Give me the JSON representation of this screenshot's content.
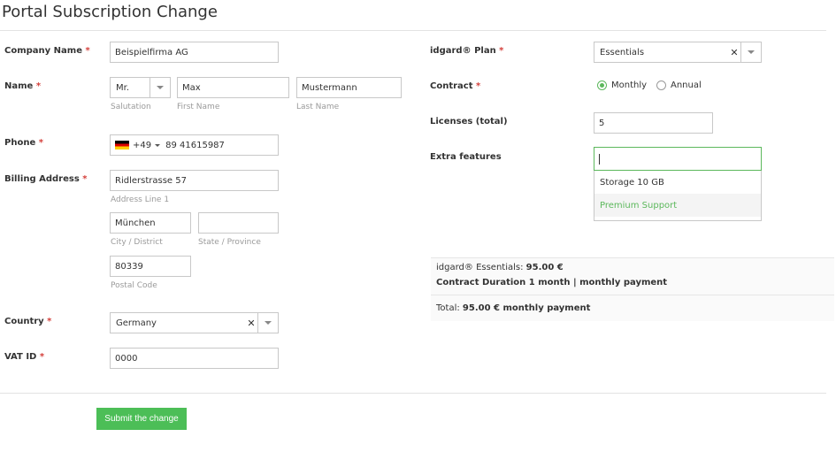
{
  "header": {
    "title": "Portal Subscription Change"
  },
  "company": {
    "label": "Company Name",
    "req": "*",
    "value": "Beispielfirma AG"
  },
  "name": {
    "label": "Name",
    "req": "*",
    "salutation": {
      "value": "Mr.",
      "hint": "Salutation"
    },
    "first": {
      "value": "Max",
      "hint": "First Name"
    },
    "last": {
      "value": "Mustermann",
      "hint": "Last Name"
    }
  },
  "phone": {
    "label": "Phone",
    "req": "*",
    "code": "+49",
    "value": "89 41615987"
  },
  "billing": {
    "label": "Billing Address",
    "req": "*",
    "line1": {
      "value": "Ridlerstrasse 57",
      "hint": "Address Line 1"
    },
    "city": {
      "value": "München",
      "hint": "City / District"
    },
    "state": {
      "value": "",
      "hint": "State / Province"
    },
    "postal": {
      "value": "80339",
      "hint": "Postal Code"
    }
  },
  "country": {
    "label": "Country",
    "req": "*",
    "value": "Germany"
  },
  "vat": {
    "label": "VAT ID",
    "req": "*",
    "value": "0000"
  },
  "plan": {
    "label": "idgard® Plan",
    "req": "*",
    "value": "Essentials"
  },
  "contract": {
    "label": "Contract",
    "req": "*",
    "options": [
      {
        "label": "Monthly",
        "selected": true
      },
      {
        "label": "Annual",
        "selected": false
      }
    ]
  },
  "licenses": {
    "label": "Licenses (total)",
    "value": "5"
  },
  "extras": {
    "label": "Extra features",
    "value": "",
    "options": [
      "Storage 10 GB",
      "Premium Support"
    ]
  },
  "summary": {
    "plan_prefix": "idgard® Essentials: ",
    "plan_price": "95.00 €",
    "duration": "Contract Duration 1 month | monthly payment",
    "total_prefix": "Total: ",
    "total_value": "95.00 € monthly payment"
  },
  "actions": {
    "submit": "Submit the change"
  },
  "colors": {
    "accent": "#4cbe57",
    "required": "#d43f3a",
    "link_green": "#5cb85c"
  }
}
